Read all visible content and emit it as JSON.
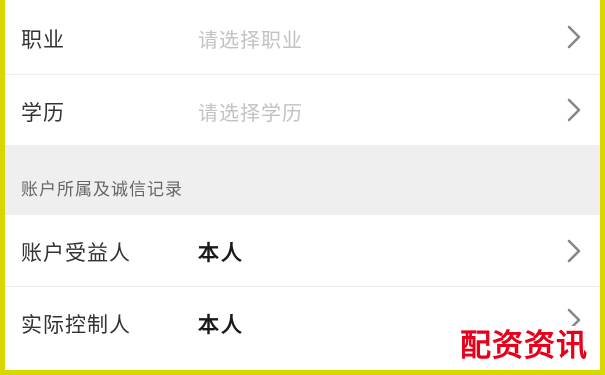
{
  "rows_top": [
    {
      "label": "职业",
      "placeholder": "请选择职业",
      "icon": "chevron-right-icon"
    },
    {
      "label": "学历",
      "placeholder": "请选择学历",
      "icon": "chevron-right-icon"
    }
  ],
  "section": {
    "title": "账户所属及诚信记录"
  },
  "rows_bottom": [
    {
      "label": "账户受益人",
      "value": "本人",
      "icon": "chevron-right-icon"
    },
    {
      "label": "实际控制人",
      "value": "本人",
      "icon": "chevron-right-icon"
    }
  ],
  "watermark": {
    "text": "配资资讯",
    "color": "#e8001a"
  },
  "colors": {
    "border": "#d8d800",
    "section_bg": "#efefef",
    "placeholder": "#c2c2c2"
  }
}
